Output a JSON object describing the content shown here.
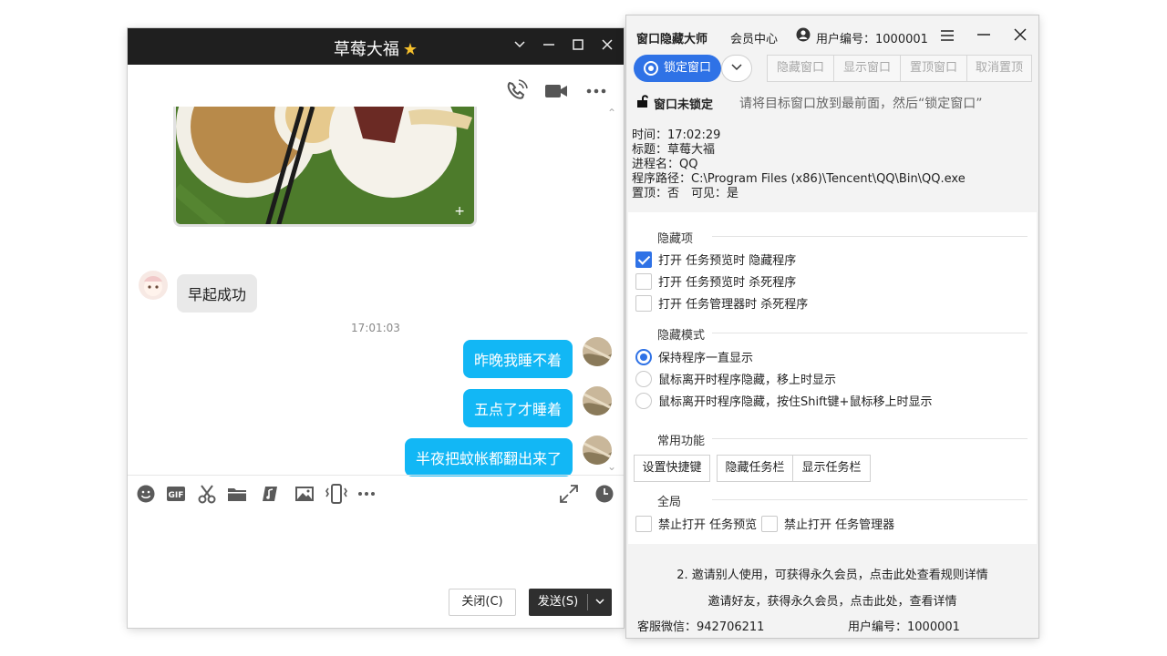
{
  "chat": {
    "title": "草莓大福",
    "title_star": "★",
    "messages": {
      "received_1": "早起成功",
      "timestamp": "17:01:03",
      "sent_1": "昨晚我睡不着",
      "sent_2": "五点了才睡着",
      "sent_3": "半夜把蚊帐都翻出来了"
    },
    "buttons": {
      "close": "关闭(C)",
      "send": "发送(S)"
    }
  },
  "tool": {
    "app_title": "窗口隐藏大师",
    "member_center": "会员中心",
    "user_id_label": "用户编号：1000001",
    "lock_window": "锁定窗口",
    "hide_window": "隐藏窗口",
    "show_window": "显示窗口",
    "pin_window": "置顶窗口",
    "unpin_window": "取消置顶",
    "status": "窗口未锁定",
    "hint": "请将目标窗口放到最前面，然后“锁定窗口”",
    "info": {
      "time": "时间：17:02:29",
      "title": "标题：草莓大福",
      "process": "进程名：QQ",
      "path": "程序路径：C:\\Program Files (x86)\\Tencent\\QQ\\Bin\\QQ.exe",
      "flags": "置顶：否　可见：是"
    },
    "sections": {
      "hide_items": "隐藏项",
      "hide_mode": "隐藏模式",
      "common": "常用功能",
      "global": "全局"
    },
    "hide_items": [
      {
        "label": "打开 任务预览时 隐藏程序",
        "checked": true
      },
      {
        "label": "打开 任务预览时 杀死程序",
        "checked": false
      },
      {
        "label": "打开 任务管理器时 杀死程序",
        "checked": false
      }
    ],
    "hide_modes": [
      {
        "label": "保持程序一直显示",
        "selected": true
      },
      {
        "label": "鼠标离开时程序隐藏，移上时显示",
        "selected": false
      },
      {
        "label": "鼠标离开时程序隐藏，按住Shift键+鼠标移上时显示",
        "selected": false
      }
    ],
    "common_buttons": {
      "hotkey": "设置快捷键",
      "hide_taskbar": "隐藏任务栏",
      "show_taskbar": "显示任务栏"
    },
    "global_options": {
      "disable_preview": "禁止打开 任务预览",
      "disable_taskmgr": "禁止打开 任务管理器"
    },
    "footer": {
      "invite_rule": "2. 邀请别人使用，可获得永久会员，点击此处查看规则详情",
      "invite_friend": "邀请好友，获得永久会员，点击此处，查看详情",
      "support_wechat": "客服微信：942706211",
      "user_id": "用户编号：1000001"
    }
  }
}
